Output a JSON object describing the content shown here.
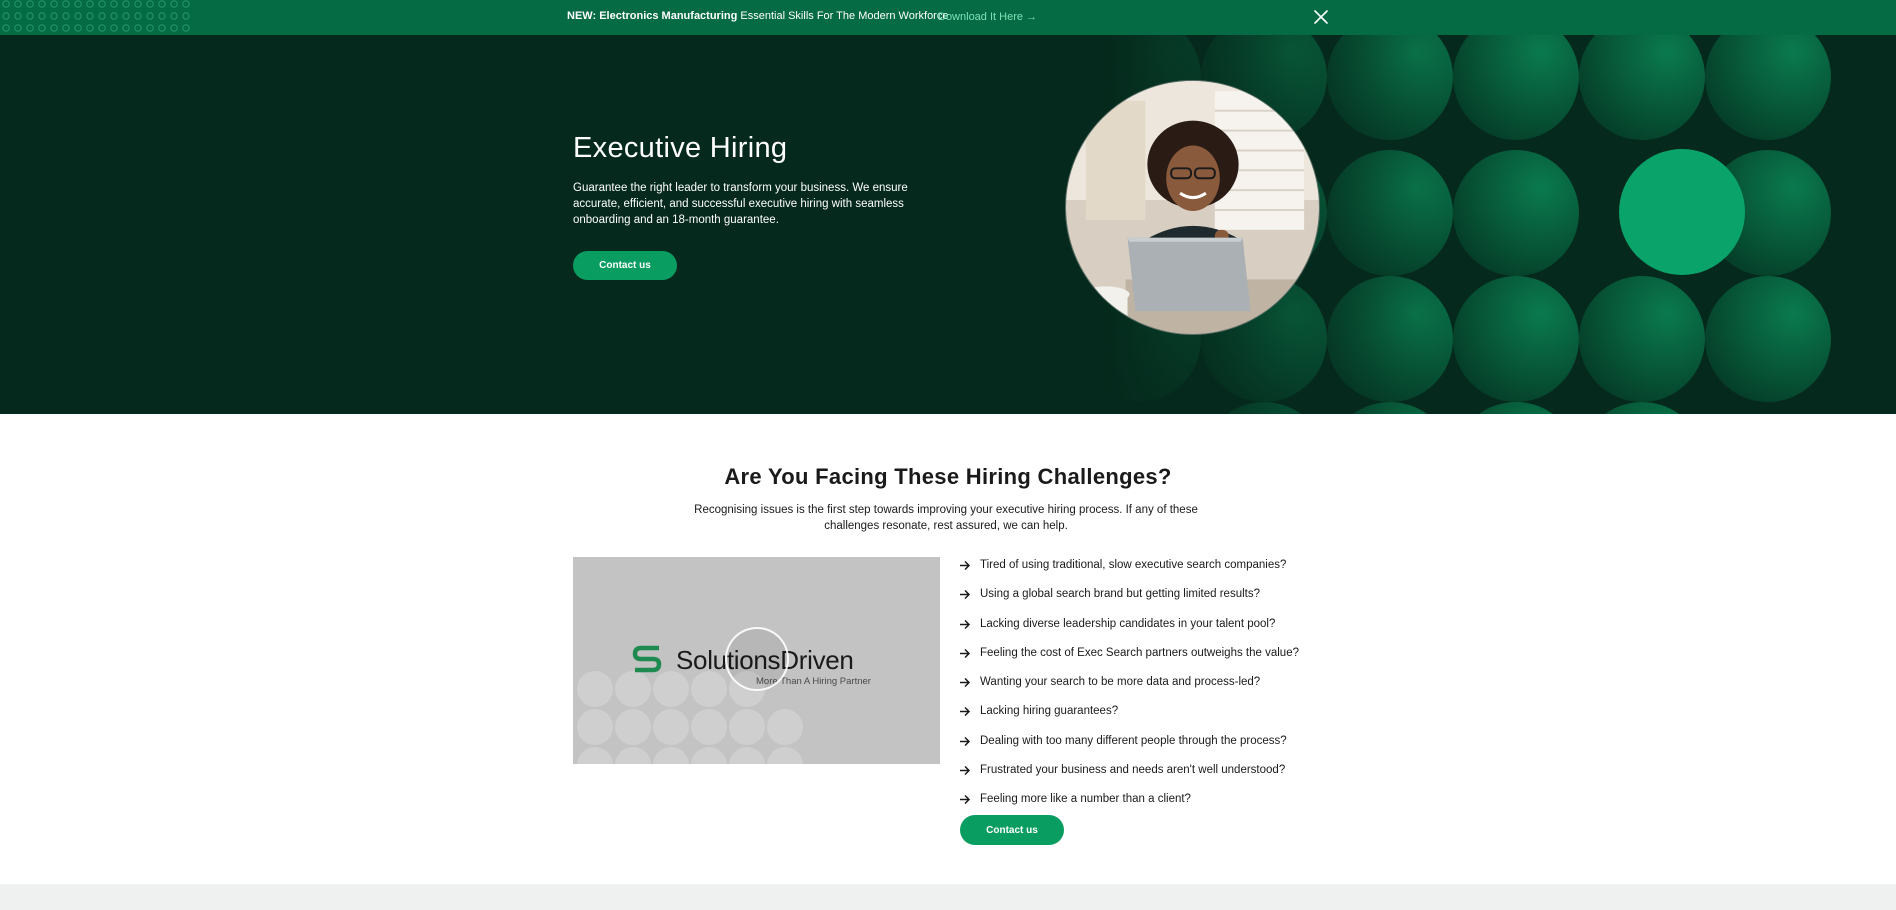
{
  "announcement": {
    "prefix": "NEW:",
    "highlight": "Electronics Manufacturing",
    "rest": "Essential Skills For The Modern Workforce",
    "link_label": "Download It Here",
    "link_icon": "arrow-right-icon",
    "close_icon": "close-icon"
  },
  "hero": {
    "title": "Executive Hiring",
    "description": "Guarantee the right leader to transform your business. We ensure accurate, efficient, and successful executive hiring with seamless onboarding and an 18-month guarantee.",
    "cta_label": "Contact us",
    "image": "smiling-woman-at-laptop-photo"
  },
  "challenges": {
    "title": "Are You Facing These Hiring Challenges?",
    "subtitle": "Recognising issues is the first step towards improving your executive hiring process. If any of these challenges resonate, rest assured, we can help.",
    "video": {
      "brand": "SolutionsDriven",
      "tagline": "More Than A Hiring Partner",
      "play_icon": "play-icon"
    },
    "items": [
      "Tired of using traditional, slow executive search companies?",
      "Using a global search brand but getting limited results?",
      "Lacking diverse leadership candidates in your talent pool?",
      "Feeling the cost of Exec Search partners outweighs the value?",
      "Wanting your search to be more data and process-led?",
      "Lacking hiring guarantees?",
      "Dealing with too many different people through the process?",
      "Frustrated your business and needs aren't well understood?",
      "Feeling more like a number than a client?"
    ],
    "item_icon": "arrow-right-icon",
    "cta_label": "Contact us"
  },
  "colors": {
    "brand_green": "#0a9d62",
    "topbar": "#056b45",
    "hero_bg": "#05291c"
  }
}
